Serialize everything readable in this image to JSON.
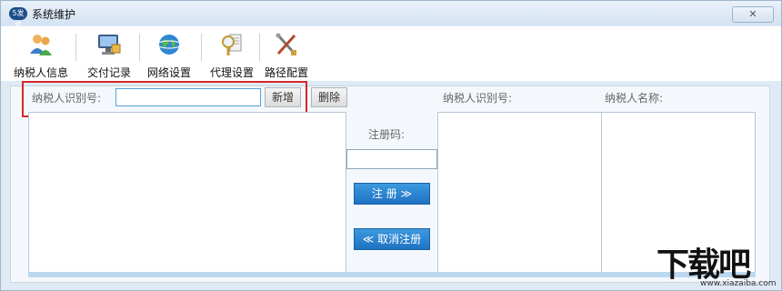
{
  "window": {
    "title": "系统维护",
    "logo_text": "5发票",
    "close_glyph": "✕"
  },
  "toolbar": {
    "items": [
      {
        "label": "纳税人信息",
        "icon": "users-icon"
      },
      {
        "label": "交付记录",
        "icon": "monitor-icon"
      },
      {
        "label": "网络设置",
        "icon": "globe-icon"
      },
      {
        "label": "代理设置",
        "icon": "magnifier-icon"
      },
      {
        "label": "路径配置",
        "icon": "tools-icon"
      }
    ]
  },
  "search": {
    "label": "纳税人识别号:",
    "value": "",
    "add_label": "新增",
    "delete_label": "删除"
  },
  "register": {
    "code_label": "注册码:",
    "register_label": "注 册 ≫",
    "unregister_label": "≪ 取消注册"
  },
  "right_table": {
    "col_id": "纳税人识别号:",
    "col_name": "纳税人名称:"
  },
  "watermark": {
    "main": "下载吧",
    "url": "www.xiazaiba.com"
  },
  "colors": {
    "accent_blue": "#1f72c2",
    "highlight_red": "#d62828"
  }
}
